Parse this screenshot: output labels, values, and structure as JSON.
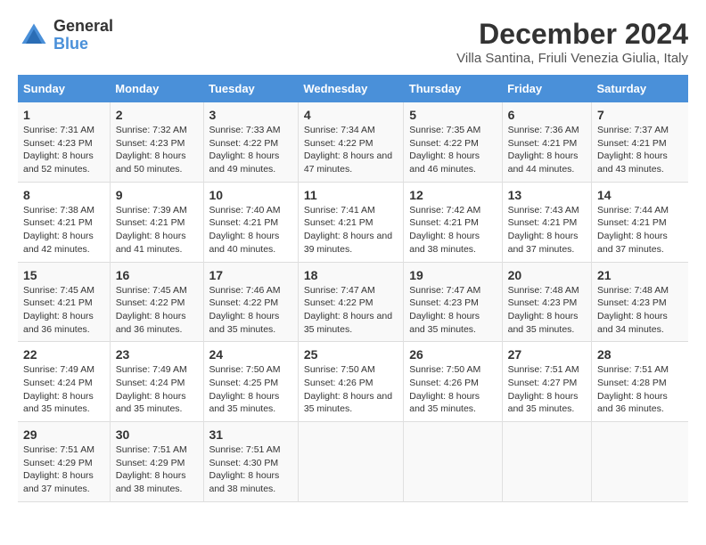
{
  "header": {
    "logo": {
      "general": "General",
      "blue": "Blue"
    },
    "title": "December 2024",
    "subtitle": "Villa Santina, Friuli Venezia Giulia, Italy"
  },
  "calendar": {
    "days_of_week": [
      "Sunday",
      "Monday",
      "Tuesday",
      "Wednesday",
      "Thursday",
      "Friday",
      "Saturday"
    ],
    "weeks": [
      [
        null,
        null,
        null,
        null,
        null,
        null,
        null
      ]
    ],
    "cells": [
      [
        {
          "day": "1",
          "sunrise": "7:31 AM",
          "sunset": "4:23 PM",
          "daylight": "8 hours and 52 minutes."
        },
        {
          "day": "2",
          "sunrise": "7:32 AM",
          "sunset": "4:23 PM",
          "daylight": "8 hours and 50 minutes."
        },
        {
          "day": "3",
          "sunrise": "7:33 AM",
          "sunset": "4:22 PM",
          "daylight": "8 hours and 49 minutes."
        },
        {
          "day": "4",
          "sunrise": "7:34 AM",
          "sunset": "4:22 PM",
          "daylight": "8 hours and 47 minutes."
        },
        {
          "day": "5",
          "sunrise": "7:35 AM",
          "sunset": "4:22 PM",
          "daylight": "8 hours and 46 minutes."
        },
        {
          "day": "6",
          "sunrise": "7:36 AM",
          "sunset": "4:21 PM",
          "daylight": "8 hours and 44 minutes."
        },
        {
          "day": "7",
          "sunrise": "7:37 AM",
          "sunset": "4:21 PM",
          "daylight": "8 hours and 43 minutes."
        }
      ],
      [
        {
          "day": "8",
          "sunrise": "7:38 AM",
          "sunset": "4:21 PM",
          "daylight": "8 hours and 42 minutes."
        },
        {
          "day": "9",
          "sunrise": "7:39 AM",
          "sunset": "4:21 PM",
          "daylight": "8 hours and 41 minutes."
        },
        {
          "day": "10",
          "sunrise": "7:40 AM",
          "sunset": "4:21 PM",
          "daylight": "8 hours and 40 minutes."
        },
        {
          "day": "11",
          "sunrise": "7:41 AM",
          "sunset": "4:21 PM",
          "daylight": "8 hours and 39 minutes."
        },
        {
          "day": "12",
          "sunrise": "7:42 AM",
          "sunset": "4:21 PM",
          "daylight": "8 hours and 38 minutes."
        },
        {
          "day": "13",
          "sunrise": "7:43 AM",
          "sunset": "4:21 PM",
          "daylight": "8 hours and 37 minutes."
        },
        {
          "day": "14",
          "sunrise": "7:44 AM",
          "sunset": "4:21 PM",
          "daylight": "8 hours and 37 minutes."
        }
      ],
      [
        {
          "day": "15",
          "sunrise": "7:45 AM",
          "sunset": "4:21 PM",
          "daylight": "8 hours and 36 minutes."
        },
        {
          "day": "16",
          "sunrise": "7:45 AM",
          "sunset": "4:22 PM",
          "daylight": "8 hours and 36 minutes."
        },
        {
          "day": "17",
          "sunrise": "7:46 AM",
          "sunset": "4:22 PM",
          "daylight": "8 hours and 35 minutes."
        },
        {
          "day": "18",
          "sunrise": "7:47 AM",
          "sunset": "4:22 PM",
          "daylight": "8 hours and 35 minutes."
        },
        {
          "day": "19",
          "sunrise": "7:47 AM",
          "sunset": "4:23 PM",
          "daylight": "8 hours and 35 minutes."
        },
        {
          "day": "20",
          "sunrise": "7:48 AM",
          "sunset": "4:23 PM",
          "daylight": "8 hours and 35 minutes."
        },
        {
          "day": "21",
          "sunrise": "7:48 AM",
          "sunset": "4:23 PM",
          "daylight": "8 hours and 34 minutes."
        }
      ],
      [
        {
          "day": "22",
          "sunrise": "7:49 AM",
          "sunset": "4:24 PM",
          "daylight": "8 hours and 35 minutes."
        },
        {
          "day": "23",
          "sunrise": "7:49 AM",
          "sunset": "4:24 PM",
          "daylight": "8 hours and 35 minutes."
        },
        {
          "day": "24",
          "sunrise": "7:50 AM",
          "sunset": "4:25 PM",
          "daylight": "8 hours and 35 minutes."
        },
        {
          "day": "25",
          "sunrise": "7:50 AM",
          "sunset": "4:26 PM",
          "daylight": "8 hours and 35 minutes."
        },
        {
          "day": "26",
          "sunrise": "7:50 AM",
          "sunset": "4:26 PM",
          "daylight": "8 hours and 35 minutes."
        },
        {
          "day": "27",
          "sunrise": "7:51 AM",
          "sunset": "4:27 PM",
          "daylight": "8 hours and 35 minutes."
        },
        {
          "day": "28",
          "sunrise": "7:51 AM",
          "sunset": "4:28 PM",
          "daylight": "8 hours and 36 minutes."
        }
      ],
      [
        {
          "day": "29",
          "sunrise": "7:51 AM",
          "sunset": "4:29 PM",
          "daylight": "8 hours and 37 minutes."
        },
        {
          "day": "30",
          "sunrise": "7:51 AM",
          "sunset": "4:29 PM",
          "daylight": "8 hours and 38 minutes."
        },
        {
          "day": "31",
          "sunrise": "7:51 AM",
          "sunset": "4:30 PM",
          "daylight": "8 hours and 38 minutes."
        },
        null,
        null,
        null,
        null
      ]
    ]
  }
}
